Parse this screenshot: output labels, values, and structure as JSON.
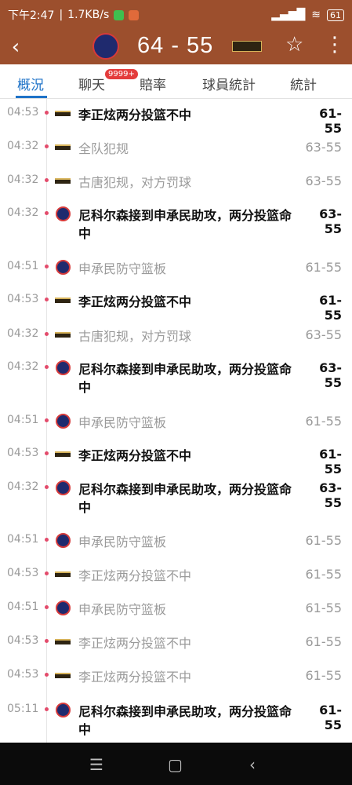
{
  "status_bar": {
    "time": "下午2:47",
    "speed": "1.7KB/s",
    "battery": "61",
    "signal_icon": "signal-bars-icon",
    "wifi_icon": "wifi-icon"
  },
  "header": {
    "score": "64 - 55",
    "back_icon": "‹",
    "star_icon": "☆",
    "menu_icon": "⋮"
  },
  "tabs": [
    {
      "label": "概況"
    },
    {
      "label": "聊天"
    },
    {
      "label": "賠率"
    },
    {
      "label": "球員統計"
    },
    {
      "label": "統計"
    }
  ],
  "chat_badge": "9999+",
  "events": [
    {
      "time": "04:53",
      "team": "away",
      "desc": "李正炫两分投篮不中",
      "score": "61-55",
      "bold": true
    },
    {
      "time": "04:32",
      "team": "away",
      "desc": "全队犯规",
      "score": "63-55",
      "bold": false
    },
    {
      "time": "04:32",
      "team": "away",
      "desc": "古唐犯规，对方罚球",
      "score": "63-55",
      "bold": false
    },
    {
      "time": "04:32",
      "team": "home",
      "desc": "尼科尔森接到申承民助攻，两分投篮命中",
      "score": "63-55",
      "bold": true
    },
    {
      "time": "04:51",
      "team": "home",
      "desc": "申承民防守篮板",
      "score": "61-55",
      "bold": false
    },
    {
      "time": "04:53",
      "team": "away",
      "desc": "李正炫两分投篮不中",
      "score": "61-55",
      "bold": true
    },
    {
      "time": "04:32",
      "team": "away",
      "desc": "古唐犯规，对方罚球",
      "score": "63-55",
      "bold": false
    },
    {
      "time": "04:32",
      "team": "home",
      "desc": "尼科尔森接到申承民助攻，两分投篮命中",
      "score": "63-55",
      "bold": true
    },
    {
      "time": "04:51",
      "team": "home",
      "desc": "申承民防守篮板",
      "score": "61-55",
      "bold": false
    },
    {
      "time": "04:53",
      "team": "away",
      "desc": "李正炫两分投篮不中",
      "score": "61-55",
      "bold": true
    },
    {
      "time": "04:32",
      "team": "home",
      "desc": "尼科尔森接到申承民助攻，两分投篮命中",
      "score": "63-55",
      "bold": true
    },
    {
      "time": "04:51",
      "team": "home",
      "desc": "申承民防守篮板",
      "score": "61-55",
      "bold": false
    },
    {
      "time": "04:53",
      "team": "away",
      "desc": "李正炫两分投篮不中",
      "score": "61-55",
      "bold": false
    },
    {
      "time": "04:51",
      "team": "home",
      "desc": "申承民防守篮板",
      "score": "61-55",
      "bold": false
    },
    {
      "time": "04:53",
      "team": "away",
      "desc": "李正炫两分投篮不中",
      "score": "61-55",
      "bold": false
    },
    {
      "time": "04:53",
      "team": "away",
      "desc": "李正炫两分投篮不中",
      "score": "61-55",
      "bold": false
    },
    {
      "time": "05:11",
      "team": "home",
      "desc": "尼科尔森接到申承民助攻，两分投篮命中",
      "score": "61-55",
      "bold": true
    }
  ],
  "nav": {
    "menu_icon": "☰",
    "home_icon": "▢",
    "back_icon": "‹"
  }
}
